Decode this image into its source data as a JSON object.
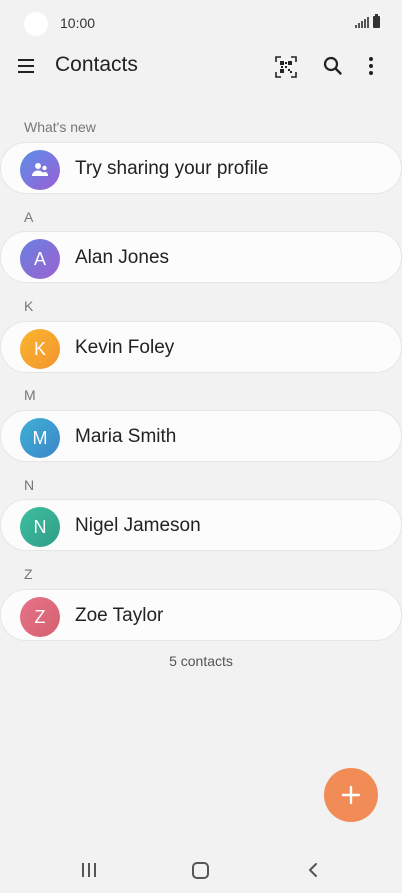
{
  "status_bar": {
    "time": "10:00"
  },
  "app_bar": {
    "title": "Contacts"
  },
  "whats_new": {
    "header": "What's new",
    "label": "Try sharing your profile",
    "avatar_color": "#7c6fd8"
  },
  "contacts": [
    {
      "letter": "A",
      "initial": "A",
      "name": "Alan Jones",
      "color": "#7d6fd6"
    },
    {
      "letter": "K",
      "initial": "K",
      "name": "Kevin Foley",
      "color": "#f4a42c"
    },
    {
      "letter": "M",
      "initial": "M",
      "name": "Maria Smith",
      "color": "#3c9fcd"
    },
    {
      "letter": "N",
      "initial": "N",
      "name": "Nigel Jameson",
      "color": "#3ab394"
    },
    {
      "letter": "Z",
      "initial": "Z",
      "name": "Zoe Taylor",
      "color": "#df6b7c"
    }
  ],
  "count_text": "5 contacts",
  "colors": {
    "fab": "#f18c57",
    "background": "#f2f2f2"
  }
}
